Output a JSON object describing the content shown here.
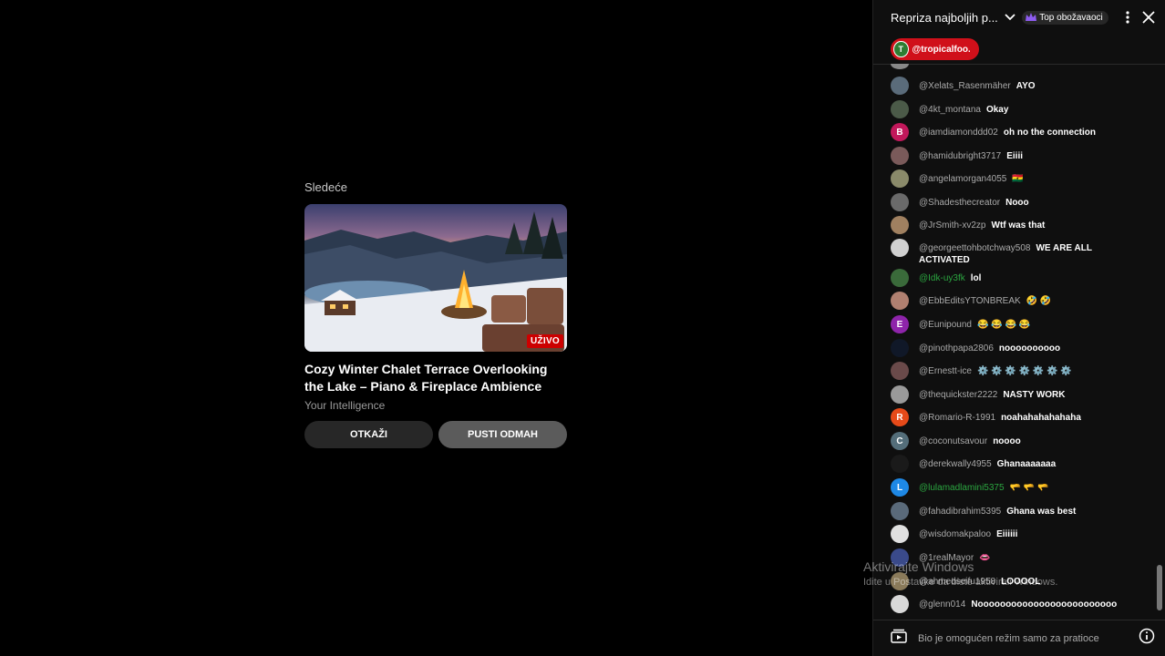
{
  "up_next": {
    "label": "Sledeće",
    "live_badge": "UŽIVO",
    "title": "Cozy Winter Chalet Terrace Overlooking the Lake – Piano & Fireplace Ambience",
    "channel": "Your Intelligence",
    "cancel_label": "OTKAŽI",
    "play_label": "PUSTI ODMAH"
  },
  "chat": {
    "title": "Repriza najboljih p...",
    "top_fans_label": "Top obožavaoci",
    "pinned_ticker": {
      "initial": "T",
      "name": "@tropicalfoo..."
    },
    "messages": [
      {
        "author": "@Xelats_Rasenmäher",
        "text": "AYO",
        "avatar_color": "#5a6b7a",
        "initial": ""
      },
      {
        "author": "@4kt_montana",
        "text": "Okay",
        "avatar_color": "#4b5a48",
        "initial": ""
      },
      {
        "author": "@iamdiamonddd02",
        "text": "oh no the connection",
        "avatar_color": "#c2185b",
        "initial": "B"
      },
      {
        "author": "@hamidubright3717",
        "text": "Eiiii",
        "avatar_color": "#7a5a5a",
        "initial": ""
      },
      {
        "author": "@angelamorgan4055",
        "text": "🇬🇭",
        "avatar_color": "#8a8a6a",
        "initial": ""
      },
      {
        "author": "@Shadesthecreator",
        "text": "Nooo",
        "avatar_color": "#6a6a6a",
        "initial": ""
      },
      {
        "author": "@JrSmith-xv2zp",
        "text": "Wtf was that",
        "avatar_color": "#a08060",
        "initial": ""
      },
      {
        "author": "@georgeettohbotchway508",
        "text": "WE ARE ALL ACTIVATED",
        "avatar_color": "#d0d0d0",
        "initial": ""
      },
      {
        "author": "@Idk-uy3fk",
        "text": "lol",
        "avatar_color": "#3a6a3a",
        "initial": "",
        "member": true
      },
      {
        "author": "@EbbEditsYTONBREAK",
        "text": "🤣 🤣",
        "avatar_color": "#b08070",
        "initial": ""
      },
      {
        "author": "@Eunipound",
        "text": "😂 😂 😂 😂",
        "avatar_color": "#8e24aa",
        "initial": "E"
      },
      {
        "author": "@pinothpapa2806",
        "text": "noooooooooo",
        "avatar_color": "#101828",
        "initial": ""
      },
      {
        "author": "@Ernestt-ice",
        "text": "⚙️ ⚙️ ⚙️ ⚙️ ⚙️ ⚙️ ⚙️",
        "avatar_color": "#6a4a4a",
        "initial": ""
      },
      {
        "author": "@thequickster2222",
        "text": "NASTY WORK",
        "avatar_color": "#9a9a9a",
        "initial": ""
      },
      {
        "author": "@Romario-R-1991",
        "text": "noahahahahahaha",
        "avatar_color": "#e64a19",
        "initial": "R"
      },
      {
        "author": "@coconutsavour",
        "text": "noooo",
        "avatar_color": "#546e7a",
        "initial": "C"
      },
      {
        "author": "@derekwally4955",
        "text": "Ghanaaaaaaa",
        "avatar_color": "#1a1a1a",
        "initial": ""
      },
      {
        "author": "@lulamadlamini5375",
        "text": "🫳 🫳 🫳",
        "avatar_color": "#1e88e5",
        "initial": "L",
        "member": true
      },
      {
        "author": "@fahadibrahim5395",
        "text": "Ghana was best",
        "avatar_color": "#5a6a7a",
        "initial": ""
      },
      {
        "author": "@wisdomakpaloo",
        "text": "Eiiiiii",
        "avatar_color": "#e0e0e0",
        "initial": ""
      },
      {
        "author": "@1realMayor",
        "text": "👄",
        "avatar_color": "#3a4a8a",
        "initial": ""
      },
      {
        "author": "@ahmedseifu1958",
        "text": "LOOOOL",
        "avatar_color": "#8a7a5a",
        "initial": ""
      },
      {
        "author": "@glenn014",
        "text": "Nooooooooooooooooooooooooo",
        "avatar_color": "#d8d8d8",
        "initial": ""
      }
    ],
    "footer_text": "Bio je omogućen režim samo za pratioce"
  },
  "watermark": {
    "title": "Aktivirajte Windows",
    "subtitle": "Idite u Postavke da biste aktivirali Windows."
  }
}
